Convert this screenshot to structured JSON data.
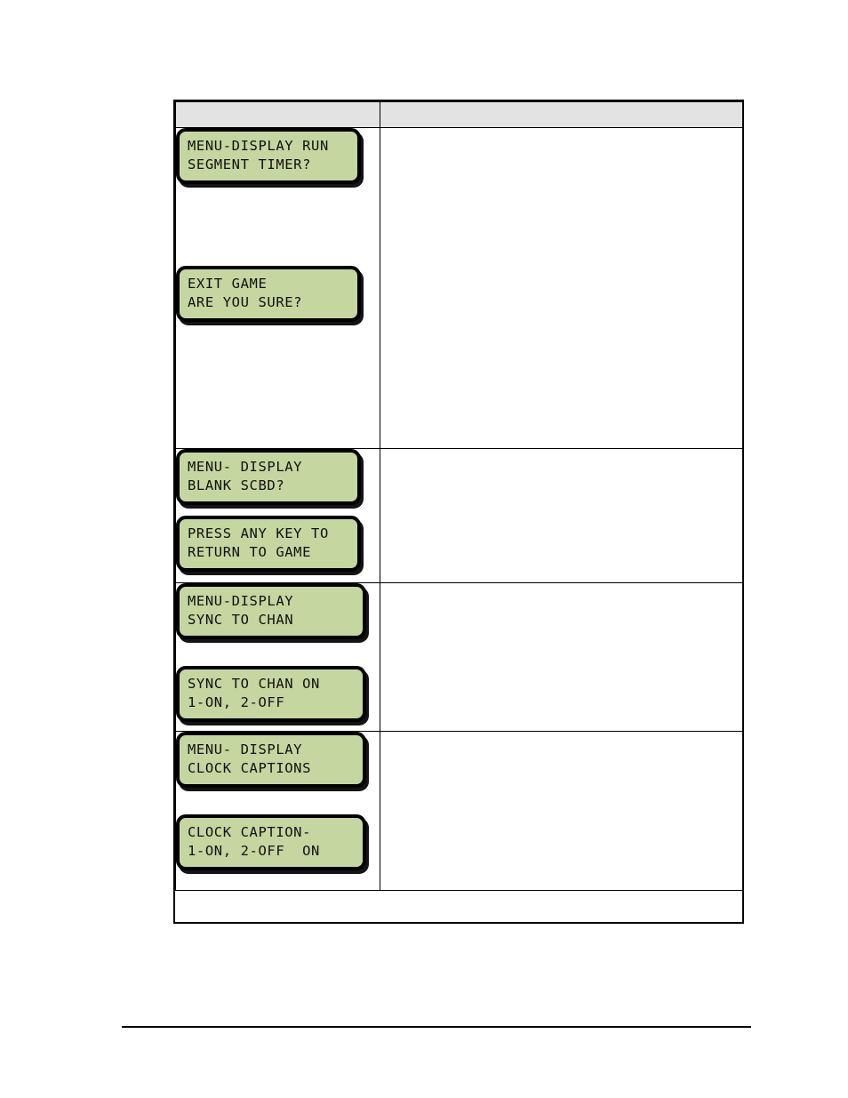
{
  "document": {
    "page_background": "#ffffff",
    "lcd_screen_color": "#c5d6a0",
    "lcd_text_color": "#111111",
    "header_fill_color": "#e3e3e3",
    "border_color": "#000000"
  },
  "table": {
    "columns": [
      {
        "id": "col-display",
        "header": ""
      },
      {
        "id": "col-description",
        "header": ""
      }
    ],
    "rows": [
      {
        "id": "row-run-segment-timer",
        "displays": [
          {
            "id": "lcd-menu-display-run-segment-timer",
            "line1": "MENU-DISPLAY RUN",
            "line2": "SEGMENT TIMER?"
          },
          {
            "id": "lcd-exit-game-are-you-sure",
            "line1": "EXIT GAME",
            "line2": "ARE YOU SURE?"
          }
        ],
        "description": ""
      },
      {
        "id": "row-blank-scbd",
        "displays": [
          {
            "id": "lcd-menu-display-blank-scbd",
            "line1": "MENU- DISPLAY",
            "line2": "BLANK SCBD?"
          },
          {
            "id": "lcd-press-any-key-to-return",
            "line1": "PRESS ANY KEY TO",
            "line2": "RETURN TO GAME"
          }
        ],
        "description": ""
      },
      {
        "id": "row-sync-to-chan",
        "displays": [
          {
            "id": "lcd-menu-display-sync-to-chan",
            "line1": "MENU-DISPLAY",
            "line2": "SYNC TO CHAN"
          },
          {
            "id": "lcd-sync-to-chan-on",
            "line1": "SYNC TO CHAN ON",
            "line2": "1-ON, 2-OFF"
          }
        ],
        "description": ""
      },
      {
        "id": "row-clock-captions",
        "displays": [
          {
            "id": "lcd-menu-display-clock-captions",
            "line1": "MENU- DISPLAY",
            "line2": "CLOCK CAPTIONS"
          },
          {
            "id": "lcd-clock-caption-on",
            "line1": "CLOCK CAPTION-",
            "line2": "1-ON, 2-OFF  ON"
          }
        ],
        "description": ""
      }
    ]
  },
  "footer": {
    "divider": ""
  }
}
